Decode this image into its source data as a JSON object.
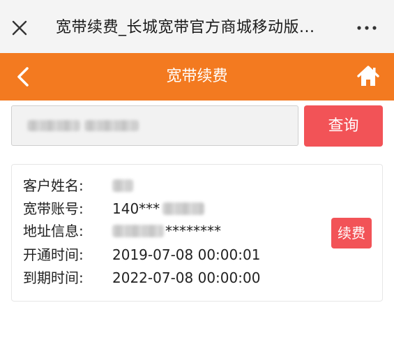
{
  "browser": {
    "title": "宽带续费_长城宽带官方商城移动版...",
    "close_icon": "close-icon",
    "more_icon": "more-dots-icon"
  },
  "header": {
    "title": "宽带续费",
    "back_icon": "chevron-left-icon",
    "home_icon": "home-icon",
    "background": "#f37a20"
  },
  "search": {
    "value": "",
    "button_label": "查询",
    "button_color": "#f25357"
  },
  "account": {
    "rows": [
      {
        "label": "客户姓名:",
        "value": ""
      },
      {
        "label": "宽带账号:",
        "value": "140***"
      },
      {
        "label": "地址信息:",
        "value": "********"
      },
      {
        "label": "开通时间:",
        "value": "2019-07-08 00:00:01"
      },
      {
        "label": "到期时间:",
        "value": "2022-07-08 00:00:00"
      }
    ],
    "renew_label": "续费"
  }
}
